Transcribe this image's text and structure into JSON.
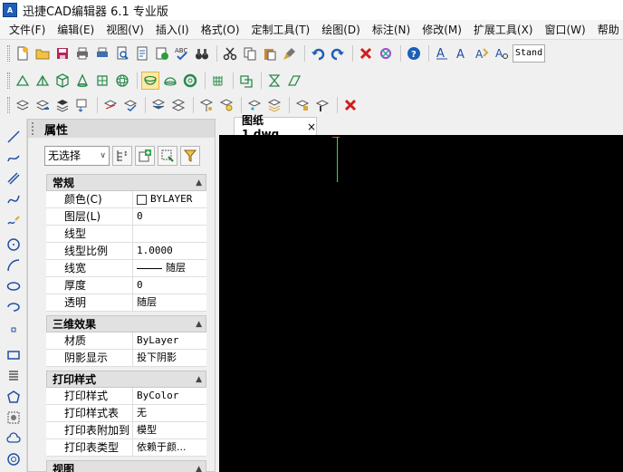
{
  "window": {
    "title": "迅捷CAD编辑器 6.1 专业版",
    "logo_text": "A"
  },
  "menu": [
    "文件(F)",
    "编辑(E)",
    "视图(V)",
    "插入(I)",
    "格式(O)",
    "定制工具(T)",
    "绘图(D)",
    "标注(N)",
    "修改(M)",
    "扩展工具(X)",
    "窗口(W)",
    "帮助"
  ],
  "toolbar": {
    "text_style_value": "Stand"
  },
  "properties_panel": {
    "title": "属性",
    "selection_value": "无选择",
    "sections": {
      "general": {
        "title": "常规",
        "rows": [
          {
            "key": "颜色(C)",
            "value": "BYLAYER"
          },
          {
            "key": "图层(L)",
            "value": "0"
          },
          {
            "key": "线型",
            "value": ""
          },
          {
            "key": "线型比例",
            "value": "1.0000"
          },
          {
            "key": "线宽",
            "value": "随层"
          },
          {
            "key": "厚度",
            "value": "0"
          },
          {
            "key": "透明",
            "value": "随层"
          }
        ]
      },
      "three_d": {
        "title": "三维效果",
        "rows": [
          {
            "key": "材质",
            "value": "ByLayer"
          },
          {
            "key": "阴影显示",
            "value": "投下阴影"
          }
        ]
      },
      "plot_style": {
        "title": "打印样式",
        "rows": [
          {
            "key": "打印样式",
            "value": "ByColor"
          },
          {
            "key": "打印样式表",
            "value": "无"
          },
          {
            "key": "打印表附加到",
            "value": "模型"
          },
          {
            "key": "打印表类型",
            "value": "依赖于颜..."
          }
        ]
      },
      "view": {
        "title": "视图"
      }
    }
  },
  "document": {
    "tab_label": "图纸1.dwg",
    "close_glyph": "×"
  },
  "colors": {
    "canvas_bg": "#000000",
    "y_axis": "#2ee62e",
    "x_axis": "#e23b3b",
    "active_tool_bg": "#fde9a6"
  }
}
